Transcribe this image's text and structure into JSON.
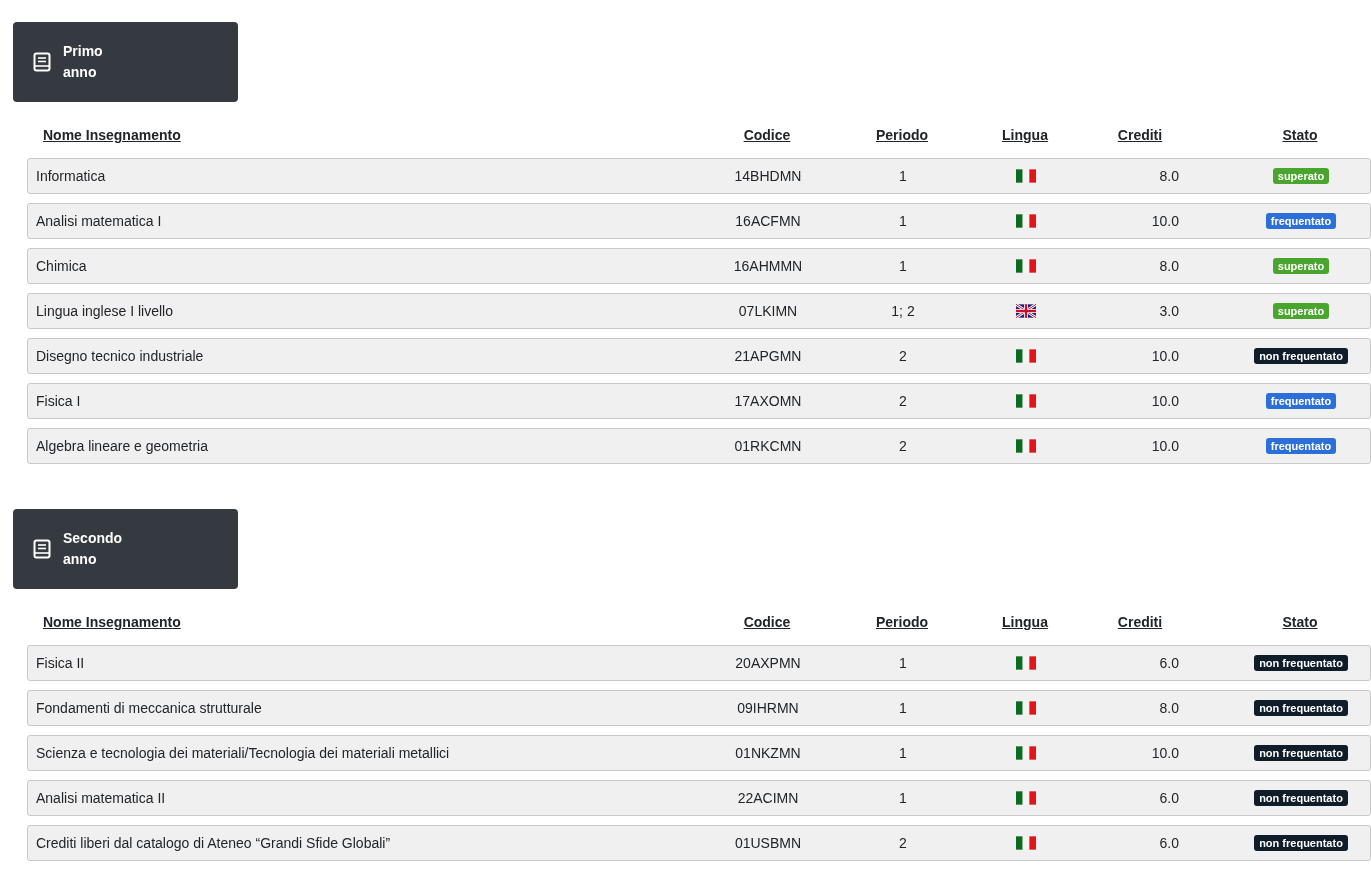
{
  "sections": [
    {
      "title": "Primo anno",
      "columns": [
        "Nome Insegnamento",
        "Codice",
        "Periodo",
        "Lingua",
        "Crediti",
        "Stato"
      ],
      "rows": [
        {
          "name": "Informatica",
          "code": "14BHDMN",
          "period": "1",
          "flag": {
            "kind": "italy"
          },
          "credits": "8.0",
          "status": {
            "label": "superato",
            "kind": "passed"
          }
        },
        {
          "name": "Analisi matematica I",
          "code": "16ACFMN",
          "period": "1",
          "flag": {
            "kind": "italy"
          },
          "credits": "10.0",
          "status": {
            "label": "frequentato",
            "kind": "attended"
          }
        },
        {
          "name": "Chimica",
          "code": "16AHMMN",
          "period": "1",
          "flag": {
            "kind": "italy"
          },
          "credits": "8.0",
          "status": {
            "label": "superato",
            "kind": "passed"
          }
        },
        {
          "name": "Lingua inglese I livello",
          "code": "07LKIMN",
          "period": "1; 2",
          "flag": {
            "kind": "uk"
          },
          "credits": "3.0",
          "status": {
            "label": "superato",
            "kind": "passed"
          }
        },
        {
          "name": "Disegno tecnico industriale",
          "code": "21APGMN",
          "period": "2",
          "flag": {
            "kind": "italy"
          },
          "credits": "10.0",
          "status": {
            "label": "non frequentato",
            "kind": "not_attended"
          }
        },
        {
          "name": "Fisica I",
          "code": "17AXOMN",
          "period": "2",
          "flag": {
            "kind": "italy"
          },
          "credits": "10.0",
          "status": {
            "label": "frequentato",
            "kind": "attended"
          }
        },
        {
          "name": "Algebra lineare e geometria",
          "code": "01RKCMN",
          "period": "2",
          "flag": {
            "kind": "italy"
          },
          "credits": "10.0",
          "status": {
            "label": "frequentato",
            "kind": "attended"
          }
        }
      ]
    },
    {
      "title": "Secondo anno",
      "columns": [
        "Nome Insegnamento",
        "Codice",
        "Periodo",
        "Lingua",
        "Crediti",
        "Stato"
      ],
      "rows": [
        {
          "name": "Fisica II",
          "code": "20AXPMN",
          "period": "1",
          "flag": {
            "kind": "italy"
          },
          "credits": "6.0",
          "status": {
            "label": "non frequentato",
            "kind": "not_attended"
          }
        },
        {
          "name": "Fondamenti di meccanica strutturale",
          "code": "09IHRMN",
          "period": "1",
          "flag": {
            "kind": "italy"
          },
          "credits": "8.0",
          "status": {
            "label": "non frequentato",
            "kind": "not_attended"
          }
        },
        {
          "name": "Scienza e tecnologia dei materiali/Tecnologia dei materiali metallici",
          "code": "01NKZMN",
          "period": "1",
          "flag": {
            "kind": "italy"
          },
          "credits": "10.0",
          "status": {
            "label": "non frequentato",
            "kind": "not_attended"
          }
        },
        {
          "name": "Analisi matematica II",
          "code": "22ACIMN",
          "period": "1",
          "flag": {
            "kind": "italy"
          },
          "credits": "6.0",
          "status": {
            "label": "non frequentato",
            "kind": "not_attended"
          }
        },
        {
          "name": "Crediti liberi dal catalogo di Ateneo “Grandi Sfide Globali”",
          "code": "01USBMN",
          "period": "2",
          "flag": {
            "kind": "italy"
          },
          "credits": "6.0",
          "status": {
            "label": "non frequentato",
            "kind": "not_attended"
          }
        }
      ]
    }
  ]
}
